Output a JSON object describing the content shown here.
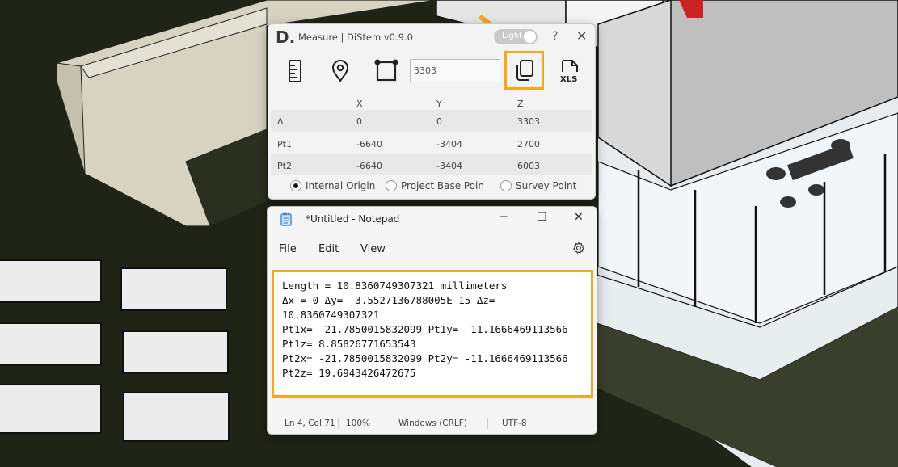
{
  "measure": {
    "logo": "D.",
    "title": "Measure | DiStem v0.9.0",
    "theme_toggle": "Light",
    "help": "?",
    "close": "✕",
    "input_value": "3303",
    "tools": [
      "ruler-icon",
      "location-pin-icon",
      "bounding-box-icon",
      "copy-icon",
      "xls-export-icon"
    ],
    "xls_label": "XLS",
    "columns": [
      "",
      "X",
      "Y",
      "Z"
    ],
    "rows": [
      {
        "label": "Δ",
        "x": "0",
        "y": "0",
        "z": "3303"
      },
      {
        "label": "Pt1",
        "x": "-6640",
        "y": "-3404",
        "z": "2700"
      },
      {
        "label": "Pt2",
        "x": "-6640",
        "y": "-3404",
        "z": "6003"
      }
    ],
    "origins": [
      {
        "label": "Internal Origin",
        "selected": true
      },
      {
        "label": "Project Base Poin",
        "selected": false
      },
      {
        "label": "Survey Point",
        "selected": false
      }
    ]
  },
  "notepad": {
    "title": "*Untitled - Notepad",
    "minimize": "─",
    "maximize": "☐",
    "close": "✕",
    "menu": [
      "File",
      "Edit",
      "View"
    ],
    "content": "Length = 10.8360749307321 millimeters\nΔx = 0 Δy= -3.5527136788005E-15 Δz= 10.8360749307321\nPt1x= -21.7850015832099 Pt1y= -11.1666469113566 Pt1z= 8.85826771653543\nPt2x= -21.7850015832099 Pt2y= -11.1666469113566 Pt2z= 19.6943426472675",
    "status": {
      "position": "Ln 4, Col 71",
      "zoom": "100%",
      "line_endings": "Windows (CRLF)",
      "encoding": "UTF-8"
    }
  },
  "colors": {
    "highlight": "#f5a623",
    "terrain": "#1f2416",
    "slab": "#d8d6c8"
  }
}
